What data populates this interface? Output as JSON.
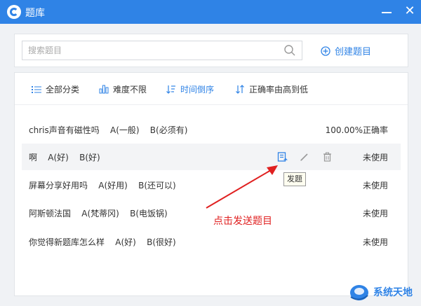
{
  "window": {
    "title": "题库",
    "close_glyph": "✕"
  },
  "search": {
    "placeholder": "搜索题目",
    "value": ""
  },
  "create_button": {
    "label": "创建题目"
  },
  "filters": [
    {
      "label": "全部分类",
      "icon": "list-icon"
    },
    {
      "label": "难度不限",
      "icon": "bar-chart-icon"
    },
    {
      "label": "时间倒序",
      "icon": "sort-time-icon"
    },
    {
      "label": "正确率由高到低",
      "icon": "sort-arrows-icon"
    }
  ],
  "questions": [
    {
      "text": "chris声音有磁性吗    A(一般)    B(必须有)",
      "status": "100.00%正确率"
    },
    {
      "text": "啊    A(好)    B(好)",
      "status": "未使用"
    },
    {
      "text": "屏幕分享好用吗    A(好用)    B(还可以)",
      "status": "未使用"
    },
    {
      "text": "阿斯顿法国    A(梵蒂冈)    B(电饭锅)",
      "status": "未使用"
    },
    {
      "text": "你觉得新题库怎么样    A(好)    B(很好)",
      "status": "未使用"
    }
  ],
  "tooltip": {
    "text": "发题"
  },
  "annotation": {
    "text": "点击发送题目"
  },
  "watermark": {
    "text": "系统天地"
  },
  "colors": {
    "titlebar": "#2f83e6",
    "accent": "#2f83e6",
    "annotation": "#e02020"
  }
}
